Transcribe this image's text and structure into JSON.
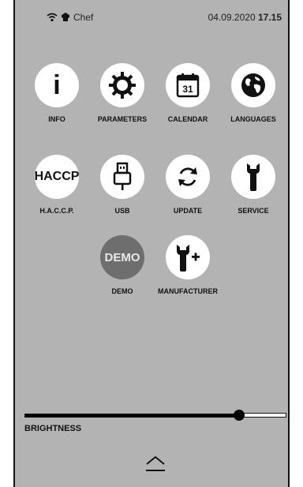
{
  "status": {
    "user": "Chef",
    "date": "04.09.2020",
    "time": "17.15"
  },
  "tiles": [
    {
      "label": "INFO",
      "glyph": "i"
    },
    {
      "label": "PARAMETERS"
    },
    {
      "label": "CALENDAR",
      "day": "31"
    },
    {
      "label": "LANGUAGES"
    },
    {
      "label": "H.A.C.C.P.",
      "glyph": "HACCP"
    },
    {
      "label": "USB"
    },
    {
      "label": "UPDATE"
    },
    {
      "label": "SERVICE"
    },
    {
      "label": "DEMO",
      "glyph": "DEMO"
    },
    {
      "label": "MANUFACTURER"
    }
  ],
  "brightness": {
    "label": "BRIGHTNESS",
    "level": 0.82
  },
  "colors": {
    "panel": "#b3b3b3",
    "tile": "#ffffff",
    "demo_tile": "#6e6e6e",
    "accent": "#000000"
  }
}
